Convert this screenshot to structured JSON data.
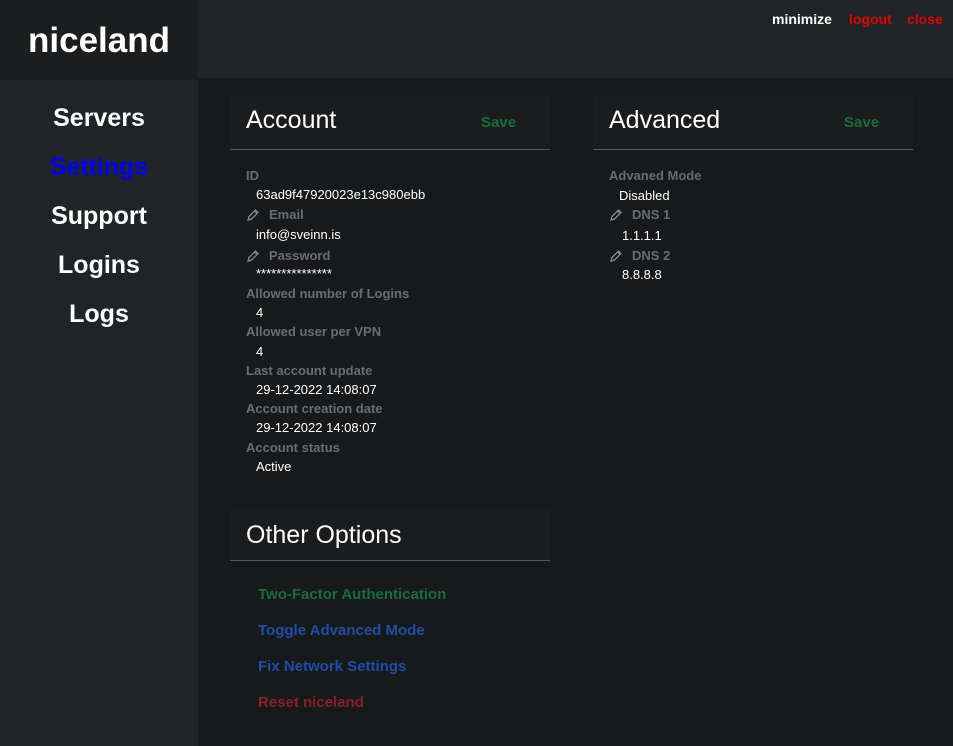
{
  "brand": "niceland",
  "nav": [
    "Servers",
    "Settings",
    "Support",
    "Logins",
    "Logs"
  ],
  "window_controls": {
    "minimize": "minimize",
    "logout": "logout",
    "close": "close"
  },
  "colors": {
    "active_nav": "#0000ff",
    "save": "#176c3e",
    "danger": "#e00000"
  },
  "account": {
    "title": "Account",
    "save_label": "Save",
    "fields": {
      "id_label": "ID",
      "id_value": "63ad9f47920023e13c980ebb",
      "email_label": "Email",
      "email_value": "info@sveinn.is",
      "password_label": "Password",
      "password_value": "***************",
      "logins_label": "Allowed number of Logins",
      "logins_value": "4",
      "users_label": "Allowed user per VPN",
      "users_value": "4",
      "update_label": "Last account update",
      "update_value": "29-12-2022 14:08:07",
      "created_label": "Account creation date",
      "created_value": "29-12-2022 14:08:07",
      "status_label": "Account status",
      "status_value": "Active"
    }
  },
  "advanced": {
    "title": "Advanced",
    "save_label": "Save",
    "fields": {
      "mode_label": "Advaned Mode",
      "mode_value": "Disabled",
      "dns1_label": "DNS 1",
      "dns1_value": "1.1.1.1",
      "dns2_label": "DNS 2",
      "dns2_value": "8.8.8.8"
    }
  },
  "other": {
    "title": "Other Options",
    "options": [
      {
        "label": "Two-Factor Authentication",
        "color": "#176c3e"
      },
      {
        "label": "Toggle Advanced Mode",
        "color": "#1d4fa8"
      },
      {
        "label": "Fix Network Settings",
        "color": "#1d4fa8"
      },
      {
        "label": "Reset niceland",
        "color": "#8a1f27"
      }
    ]
  }
}
